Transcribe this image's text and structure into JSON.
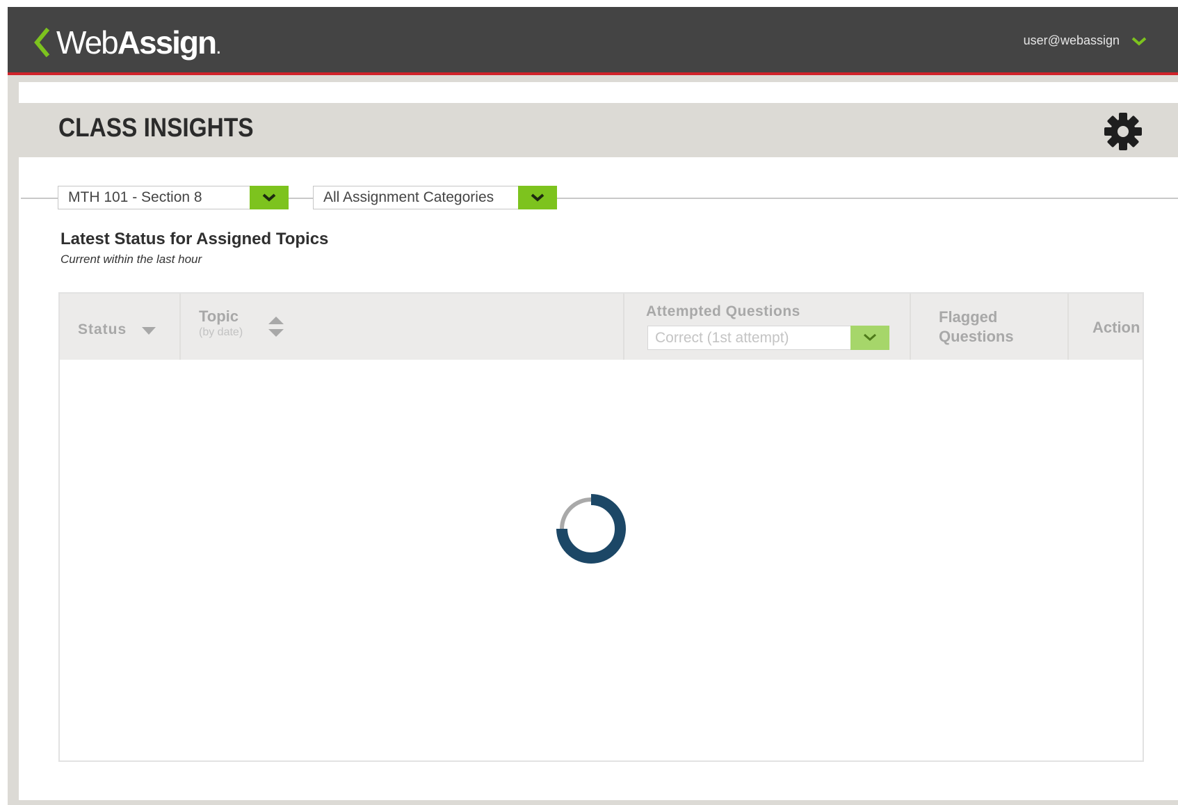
{
  "app": {
    "logo_light": "Web",
    "logo_bold": "Assign",
    "logo_dot": ".",
    "user_email": "user@webassign",
    "accent_color": "#7dc31e",
    "header_color": "#444444",
    "header_rule_color": "#d0232a"
  },
  "page": {
    "title": "CLASS INSIGHTS"
  },
  "filters": {
    "course": "MTH 101 - Section 8",
    "category": "All Assignment Categories"
  },
  "section": {
    "title": "Latest Status for Assigned Topics",
    "subtitle": "Current within the last hour"
  },
  "table": {
    "columns": {
      "status": "Status",
      "topic": "Topic",
      "topic_sub": "(by date)",
      "attempted": "Attempted Questions",
      "attempted_filter": "Correct (1st attempt)",
      "flagged": "Flagged Questions",
      "action": "Action"
    },
    "rows": []
  },
  "state": {
    "loading": true,
    "spinner_color": "#1c4766"
  },
  "icons": [
    "back-chevron-icon",
    "chevron-down-icon",
    "gear-icon",
    "sort-icon",
    "spinner-icon"
  ]
}
